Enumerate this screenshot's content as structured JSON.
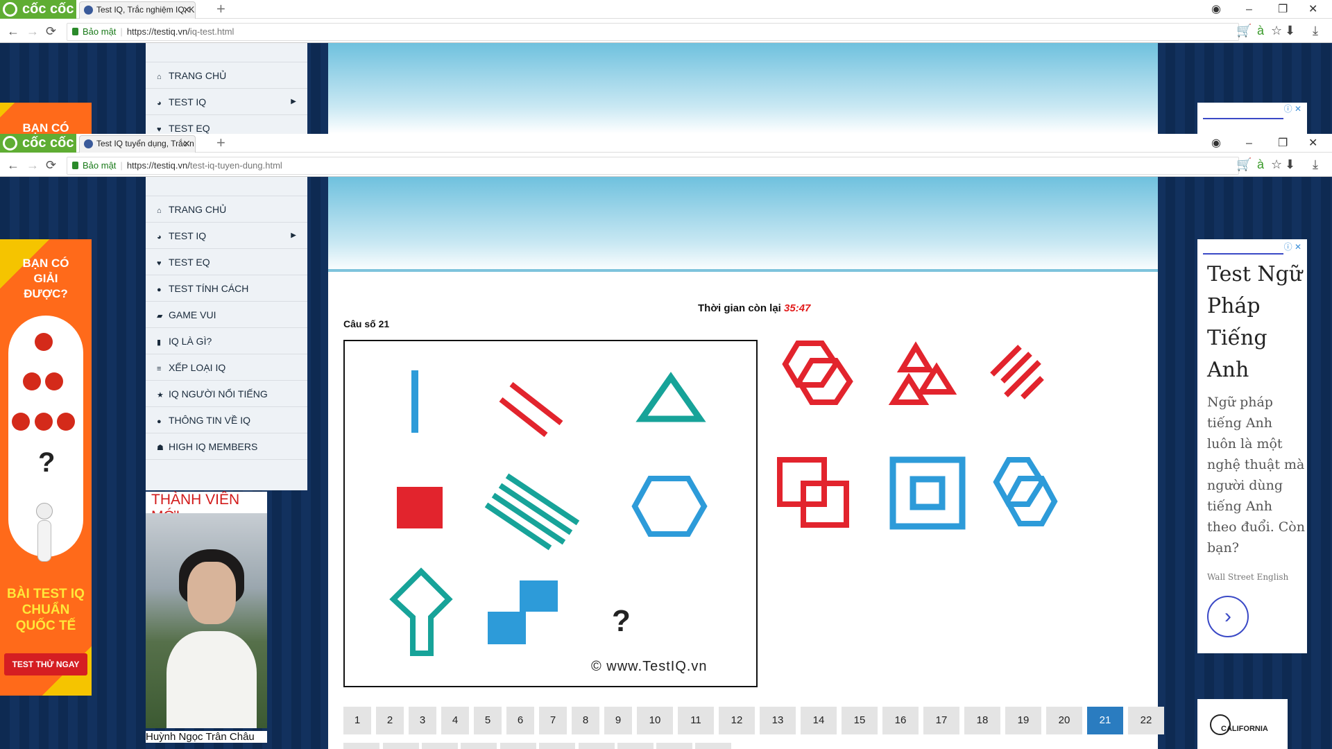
{
  "browser": {
    "brand": "cốc cốc",
    "window1": {
      "tab_title": "Test IQ, Trắc nghiệm IQ, K",
      "secure_label": "Bảo mật",
      "url_host": "https://testiq.vn/",
      "url_path": "iq-test.html"
    },
    "window2": {
      "tab_title": "Test IQ tuyển dụng, Trắc n",
      "secure_label": "Bảo mật",
      "url_host": "https://testiq.vn/",
      "url_path": "test-iq-tuyen-dung.html"
    }
  },
  "menu": {
    "items": [
      {
        "label": "TRANG CHỦ",
        "icon": "home-icon",
        "glyph": "⌂"
      },
      {
        "label": "TEST IQ",
        "icon": "brain-icon",
        "glyph": "◕",
        "has_submenu": true
      },
      {
        "label": "TEST EQ",
        "icon": "heart-icon",
        "glyph": "♥"
      },
      {
        "label": "TEST TÍNH CÁCH",
        "icon": "chat-icon",
        "glyph": "●"
      },
      {
        "label": "GAME VUI",
        "icon": "gamepad-icon",
        "glyph": "▰"
      },
      {
        "label": "IQ LÀ GÌ?",
        "icon": "book-icon",
        "glyph": "▮"
      },
      {
        "label": "XẾP LOẠI IQ",
        "icon": "list-icon",
        "glyph": "≡"
      },
      {
        "label": "IQ NGƯỜI NỔI TIẾNG",
        "icon": "star-icon",
        "glyph": "★"
      },
      {
        "label": "THÔNG TIN VỀ IQ",
        "icon": "info-icon",
        "glyph": "●"
      },
      {
        "label": "HIGH IQ MEMBERS",
        "icon": "members-icon",
        "glyph": "☗"
      }
    ],
    "window1_items": [
      {
        "label": "TRANG CHỦ",
        "glyph": "⌂"
      },
      {
        "label": "TEST IQ",
        "glyph": "◕"
      },
      {
        "label": "TEST EQ",
        "glyph": "♥"
      }
    ]
  },
  "left_ad": {
    "headline": "BẠN CÓ GIẢI ĐƯỢC?",
    "question_mark": "?",
    "bottom_text": "BÀI TEST IQ CHUẨN QUỐC TẾ",
    "button": "TEST THỬ NGAY",
    "window1_headline": "BẠN CÓ"
  },
  "right_ad": {
    "title": "Test Ngữ Pháp Tiếng Anh",
    "body": "Ngữ pháp tiếng Anh luôn là một nghệ thuật mà người dùng tiếng Anh theo đuổi. Còn bạn?",
    "source": "Wall Street English",
    "go": "›",
    "brand2": "CALIFORNIA",
    "ad_icon": "ⓘ ✕"
  },
  "quiz": {
    "timer_label": "Thời gian còn lại",
    "timer_value": "35:47",
    "question_label": "Câu số 21",
    "watermark": "© www.TestIQ.vn",
    "missing": "?"
  },
  "pagination": {
    "pages": [
      "1",
      "2",
      "3",
      "4",
      "5",
      "6",
      "7",
      "8",
      "9",
      "10",
      "11",
      "12",
      "13",
      "14",
      "15",
      "16",
      "17",
      "18",
      "19",
      "20",
      "21",
      "22"
    ],
    "active": "21"
  },
  "member": {
    "heading": "THÀNH VIÊN MỚI",
    "name": "Huỳnh Ngọc Trân Châu"
  },
  "colors": {
    "accent_blue": "#2a7cc0",
    "red": "#e2242d",
    "teal": "#17a399",
    "sky": "#2d9bd9"
  }
}
